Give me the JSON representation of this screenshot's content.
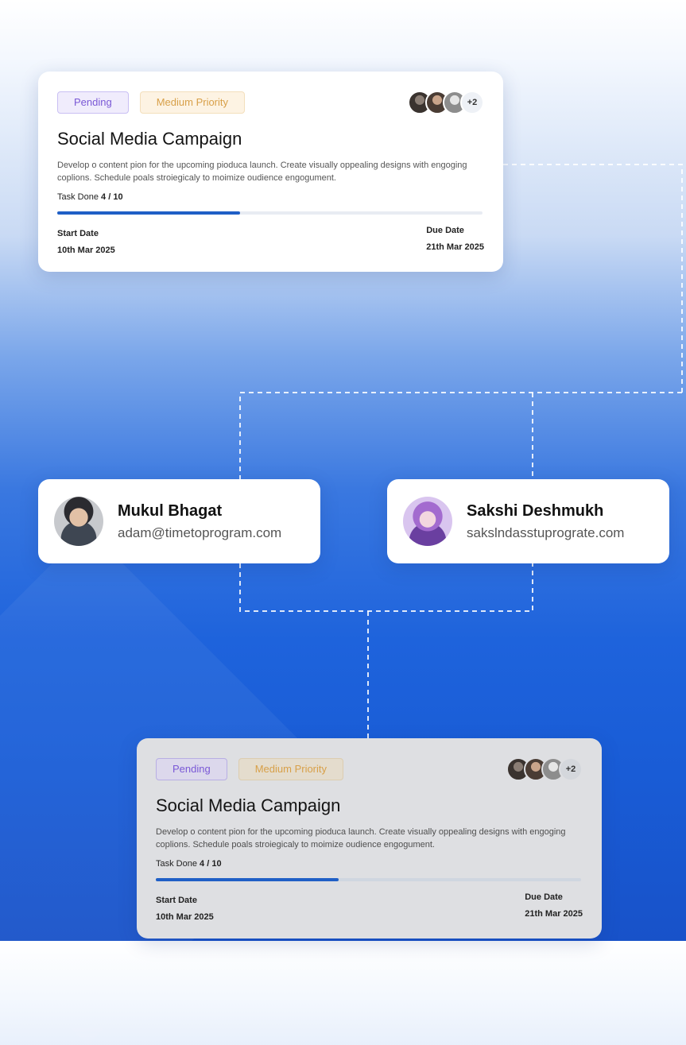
{
  "tasks": [
    {
      "status": "Pending",
      "priority": "Medium Priority",
      "members_extra": "+2",
      "title": "Social Media Campaign",
      "description": "Develop o content pion for the upcoming pioduca launch. Create visually oppealing designs with engoging coplions. Schedule poals stroiegicaly to moimize oudience engogument.",
      "task_done_label": "Task Done",
      "task_done_value": "4 / 10",
      "progress": 0.43,
      "start_label": "Start Date",
      "start_date": "10th Mar 2025",
      "due_label": "Due Date",
      "due_date": "21th Mar 2025"
    },
    {
      "status": "Pending",
      "priority": "Medium Priority",
      "members_extra": "+2",
      "title": "Social Media Campaign",
      "description": "Develop o content pion for the upcoming pioduca launch. Create visually oppealing designs with engoging coplions. Schedule poals stroiegicaly to moimize oudience engogument.",
      "task_done_label": "Task Done",
      "task_done_value": "4 / 10",
      "progress": 0.43,
      "start_label": "Start Date",
      "start_date": "10th Mar 2025",
      "due_label": "Due Date",
      "due_date": "21th Mar 2025"
    }
  ],
  "people": [
    {
      "name": "Mukul Bhagat",
      "email": "adam@timetoprogram.com"
    },
    {
      "name": "Sakshi Deshmukh",
      "email": "sakslndasstuprograte.com"
    }
  ],
  "colors": {
    "pending": "#7a58d6",
    "priority": "#d8a049",
    "progress": "#1f5fc6"
  }
}
